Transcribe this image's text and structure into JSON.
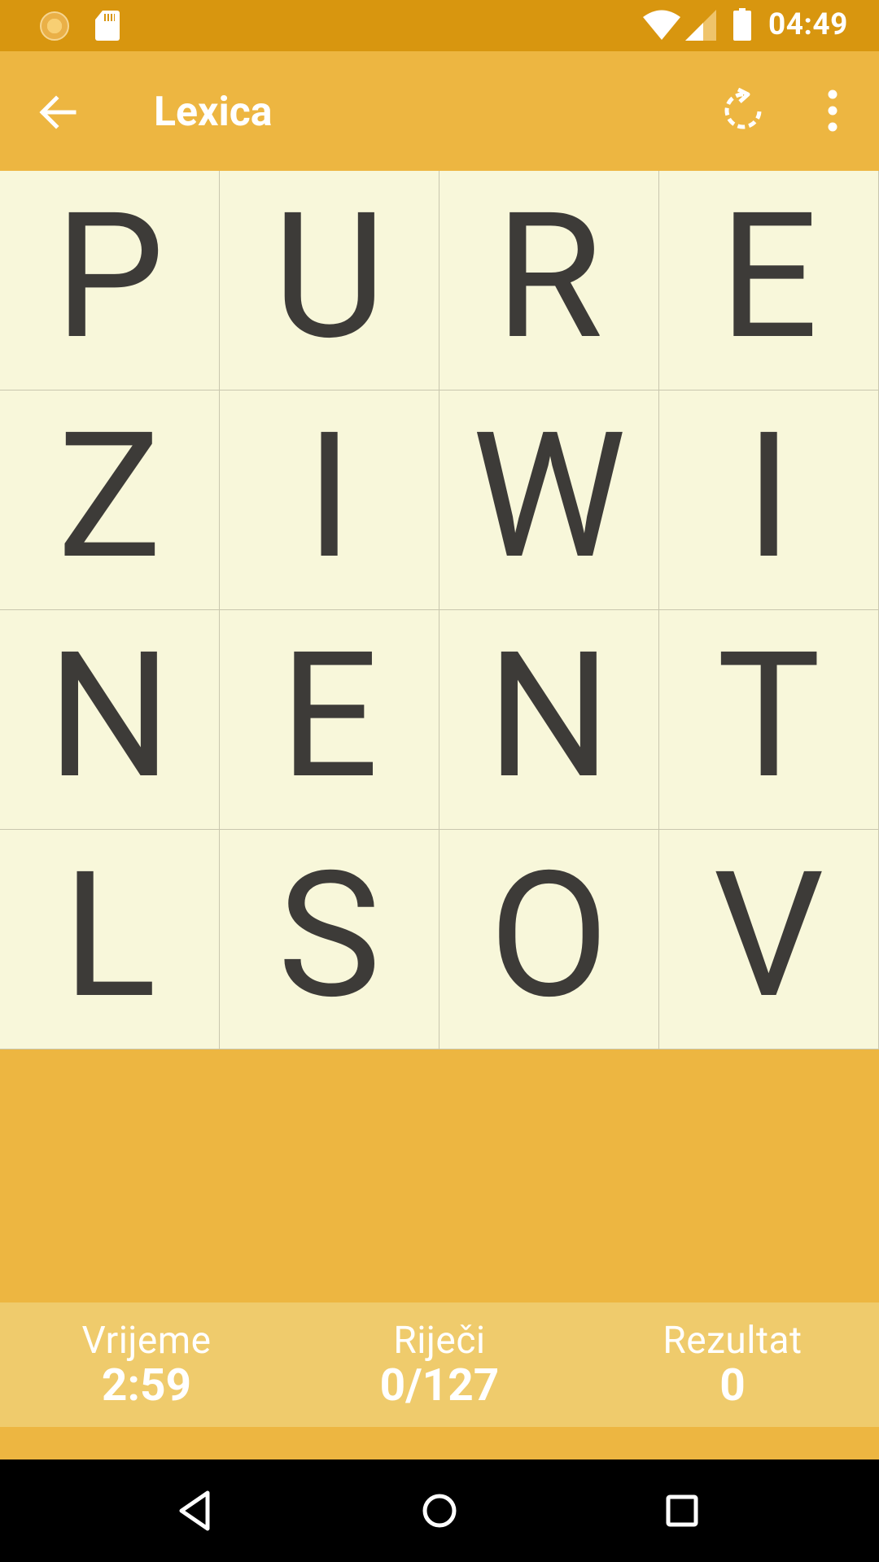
{
  "status_bar": {
    "time": "04:49",
    "icons": [
      "notification-sun-icon",
      "sd-card-icon",
      "wifi-icon",
      "signal-icon",
      "battery-icon"
    ]
  },
  "app_bar": {
    "title": "Lexica",
    "icons": [
      "back-arrow-icon",
      "refresh-icon",
      "more-vert-icon"
    ]
  },
  "board": {
    "rows": [
      [
        "P",
        "U",
        "R",
        "E"
      ],
      [
        "Z",
        "I",
        "W",
        "I"
      ],
      [
        "N",
        "E",
        "N",
        "T"
      ],
      [
        "L",
        "S",
        "O",
        "V"
      ]
    ]
  },
  "stats": {
    "time": {
      "label": "Vrijeme",
      "value": "2:59"
    },
    "words": {
      "label": "Riječi",
      "value": "0/127"
    },
    "score": {
      "label": "Rezultat",
      "value": "0"
    }
  },
  "nav_bar": {
    "icons": [
      "back-triangle-icon",
      "home-circle-icon",
      "recents-square-icon"
    ]
  },
  "colors": {
    "status_bar": "#d8960f",
    "app_bar": "#edb641",
    "board": "#f8f7da",
    "letters": "#3d3b38",
    "score_bar": "#efcb6c",
    "nav_bar": "#000000"
  }
}
